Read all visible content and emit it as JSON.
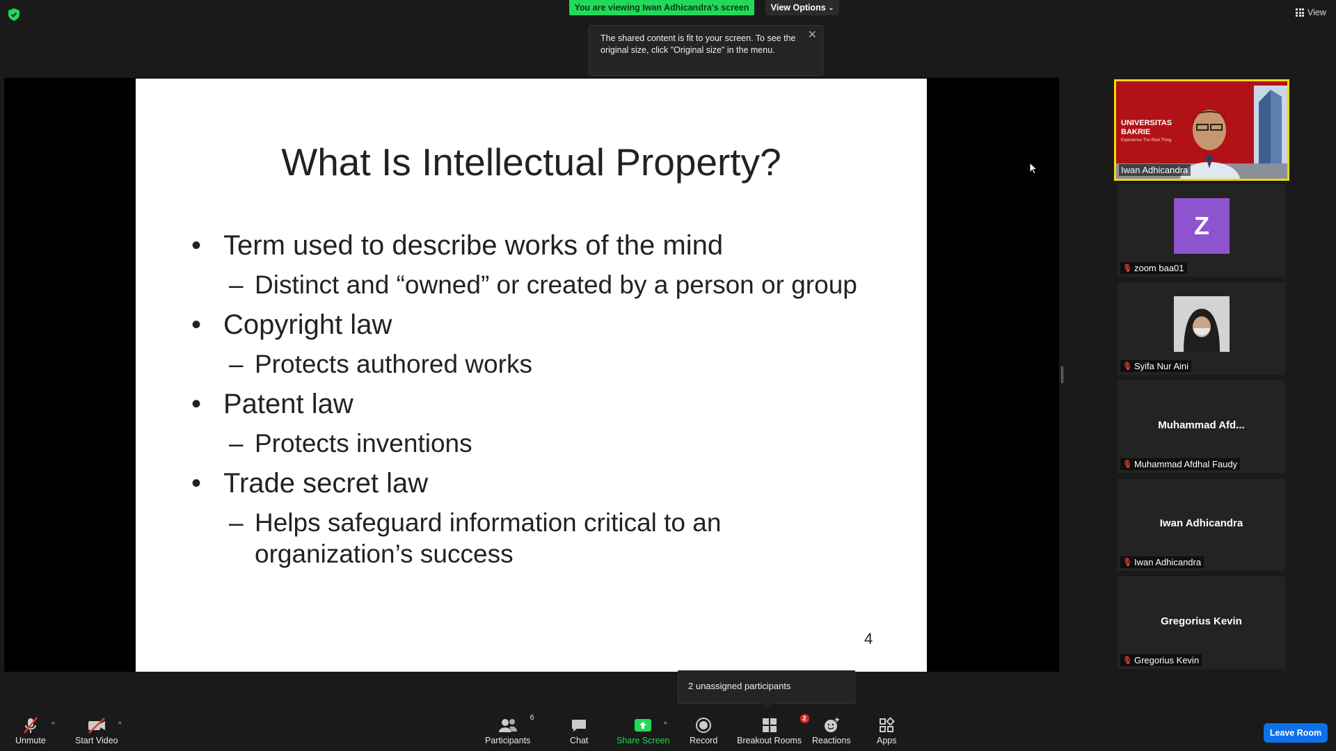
{
  "top": {
    "viewing_banner": "You are viewing Iwan Adhicandra's screen",
    "view_options": "View Options",
    "tooltip_text": "The shared content is fit to your screen. To see the original size, click \"Original size\" in the menu.",
    "view_label": "View"
  },
  "slide": {
    "title": "What Is Intellectual Property?",
    "bullets": [
      {
        "text": "Term used to describe works of the mind",
        "sub": "Distinct and “owned” or created by a person or group"
      },
      {
        "text": "Copyright law",
        "sub": "Protects authored works"
      },
      {
        "text": "Patent law",
        "sub": "Protects inventions"
      },
      {
        "text": "Trade secret law",
        "sub": "Helps safeguard information critical to an organization’s success"
      }
    ],
    "page_number": "4"
  },
  "participants": {
    "active": {
      "name": "Iwan Adhicandra",
      "video_text_1": "UNIVERSITAS",
      "video_text_2": "BAKRIE",
      "video_tagline": "Experience The Real Thing"
    },
    "tiles": [
      {
        "name": "zoom baa01",
        "avatar_letter": "Z"
      },
      {
        "name": "Syifa Nur Aini"
      },
      {
        "name": "Muhammad Afdhal Faudy",
        "display": "Muhammad  Afd..."
      },
      {
        "name": "Iwan Adhicandra",
        "display": "Iwan Adhicandra"
      },
      {
        "name": "Gregorius Kevin",
        "display": "Gregorius Kevin"
      }
    ]
  },
  "popup": {
    "unassigned": "2 unassigned participants"
  },
  "toolbar": {
    "unmute": "Unmute",
    "start_video": "Start Video",
    "participants": "Participants",
    "participants_count": "6",
    "chat": "Chat",
    "share_screen": "Share Screen",
    "record": "Record",
    "breakout_rooms": "Breakout Rooms",
    "breakout_badge": "2",
    "reactions": "Reactions",
    "apps": "Apps",
    "leave_room": "Leave Room"
  },
  "colors": {
    "banner_green": "#23d959",
    "share_green": "#23d959",
    "leave_blue": "#0e71eb",
    "active_outline": "#f2d70b",
    "avatar_purple": "#8e53cf",
    "muted_red": "#e53935"
  }
}
